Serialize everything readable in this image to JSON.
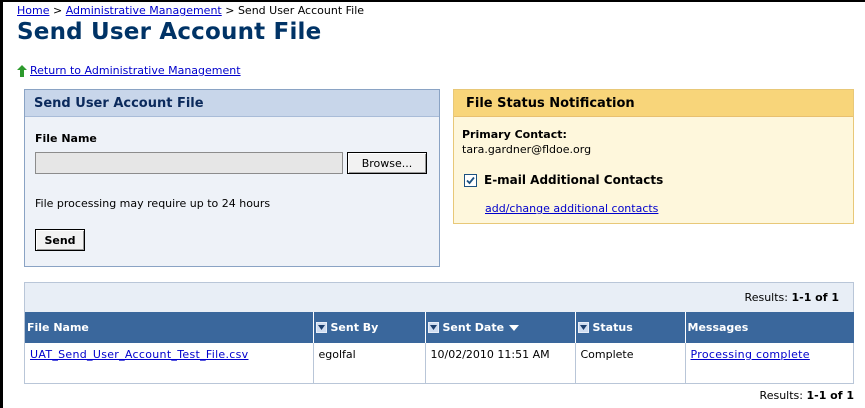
{
  "breadcrumb": {
    "home": "Home",
    "sep1": " > ",
    "admin": "Administrative Management",
    "sep2": " > ",
    "current": "Send User Account File"
  },
  "page_title": "Send User Account File",
  "return_link": "Return to Administrative Management",
  "send_panel": {
    "title": "Send User Account File",
    "file_name_label": "File Name",
    "file_name_value": "",
    "browse_label": "Browse...",
    "note": "File processing may require up to 24 hours",
    "send_label": "Send"
  },
  "notify_panel": {
    "title": "File Status Notification",
    "primary_label": "Primary Contact:",
    "primary_email": "tara.gardner@fldoe.org",
    "email_additional_label": "E-mail Additional Contacts",
    "email_additional_checked": true,
    "add_change_link": "add/change additional contacts"
  },
  "results": {
    "top_prefix": "Results: ",
    "top_range": "1-1 of 1",
    "bottom_prefix": "Results: ",
    "bottom_range": "1-1 of 1",
    "columns": {
      "file_name": "File Name",
      "sent_by": "Sent By",
      "sent_date": "Sent Date",
      "status": "Status",
      "messages": "Messages"
    },
    "rows": [
      {
        "file_name": "UAT_Send_User_Account_Test_File.csv",
        "sent_by": "egolfal",
        "sent_date": "10/02/2010 11:51 AM",
        "status": "Complete",
        "message": "Processing complete"
      }
    ]
  },
  "colors": {
    "title": "#003366",
    "link": "#0000cc",
    "send_panel_header": "#c8d6ea",
    "notify_panel_header": "#f8d57a",
    "table_header": "#3a679c"
  },
  "icons": {
    "return": "green-up-arrow-icon",
    "sort": "sort-checkbox-icon",
    "sort_desc": "triangle-down-icon"
  }
}
